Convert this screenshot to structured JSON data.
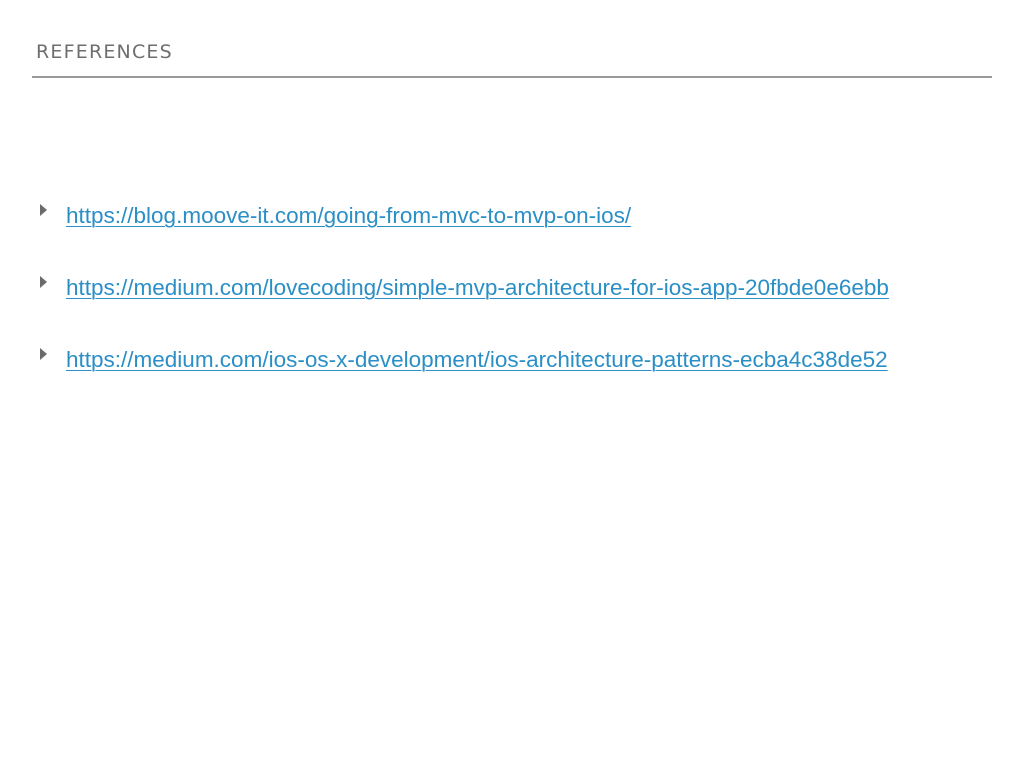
{
  "slide": {
    "title": "REFERENCES",
    "references": [
      {
        "url": "https://blog.moove-it.com/going-from-mvc-to-mvp-on-ios/"
      },
      {
        "url": "https://medium.com/lovecoding/simple-mvp-architecture-for-ios-app-20fbde0e6ebb"
      },
      {
        "url": "https://medium.com/ios-os-x-development/ios-architecture-patterns-ecba4c38de52"
      }
    ]
  },
  "colors": {
    "link": "#2b8fc6",
    "title": "#6e6e6e",
    "rule": "#9a9a9a",
    "bullet": "#6b6b6b",
    "background": "#ffffff"
  }
}
